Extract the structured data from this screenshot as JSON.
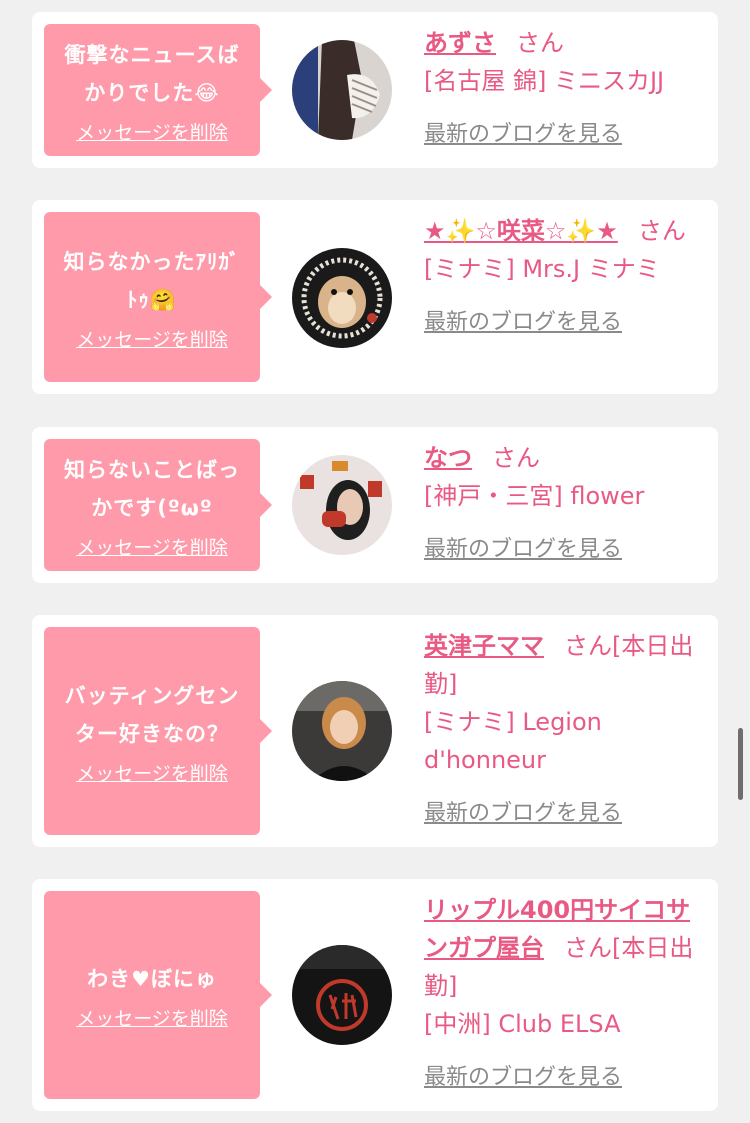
{
  "delete_label": "メッセージを削除",
  "blog_label": "最新のブログを見る",
  "san_label": "さん",
  "items": [
    {
      "bubble_lines": [
        "衝撃なニュースば",
        "かりでした😂"
      ],
      "name": "あずさ",
      "san_suffix": "",
      "area": "[名古屋 錦] ミニスカJJ",
      "avatar_icon": "woman-hiding-face-photo"
    },
    {
      "bubble_lines": [
        "知らなかったｱﾘｶﾞ",
        "ﾄｩ🤗"
      ],
      "name": "★✨☆咲菜☆✨★",
      "san_suffix": "",
      "area": "[ミナミ] Mrs.J ミナミ",
      "avatar_icon": "hamster-photo"
    },
    {
      "bubble_lines": [
        "知らないことばっ",
        "かです(ºωº"
      ],
      "name": "なつ",
      "san_suffix": "",
      "area": "[神戸・三宮] flower",
      "avatar_icon": "woman-with-mask-photo"
    },
    {
      "bubble_lines": [
        "バッティングセン",
        "ター好きなの？"
      ],
      "name": "英津子ママ",
      "san_suffix": "[本日出勤]",
      "area": "[ミナミ] Legion d'honneur",
      "avatar_icon": "smiling-woman-photo"
    },
    {
      "bubble_lines": [
        "わき♥ぼにゅ"
      ],
      "name": "リップル400円サイコサンガプ屋台",
      "san_suffix": "[本日出勤]",
      "area": "[中洲] Club ELSA",
      "avatar_icon": "secret-kanji-sign-photo"
    }
  ],
  "colors": {
    "page_bg": "#f0f0f0",
    "bubble_bg": "#ff9aaa",
    "accent_pink": "#e85a84",
    "link_gray": "#8a8a8a"
  }
}
